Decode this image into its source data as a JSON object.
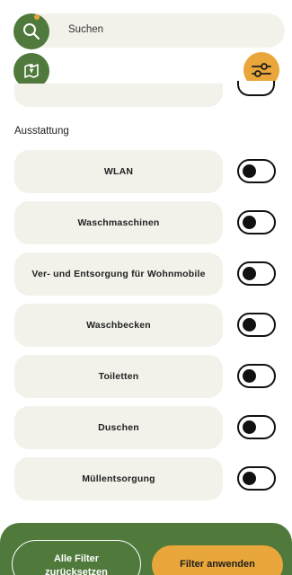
{
  "search": {
    "placeholder": "Suchen"
  },
  "section": {
    "title": "Ausstattung"
  },
  "amenities": [
    {
      "label": "WLAN",
      "enabled": false
    },
    {
      "label": "Waschmaschinen",
      "enabled": false
    },
    {
      "label": "Ver- und Entsorgung für Wohnmobile",
      "enabled": false
    },
    {
      "label": "Waschbecken",
      "enabled": false
    },
    {
      "label": "Toiletten",
      "enabled": false
    },
    {
      "label": "Duschen",
      "enabled": false
    },
    {
      "label": "Müllentsorgung",
      "enabled": false
    }
  ],
  "footer": {
    "reset_label_line1": "Alle Filter",
    "reset_label_line2": "zurücksetzen",
    "apply_label": "Filter anwenden"
  },
  "colors": {
    "primary_green": "#4f7a3c",
    "accent_orange": "#e9a63a",
    "pill_bg": "#f2f1ea"
  },
  "icons": {
    "search": "search-icon",
    "map": "map-icon",
    "filter": "sliders-icon"
  }
}
